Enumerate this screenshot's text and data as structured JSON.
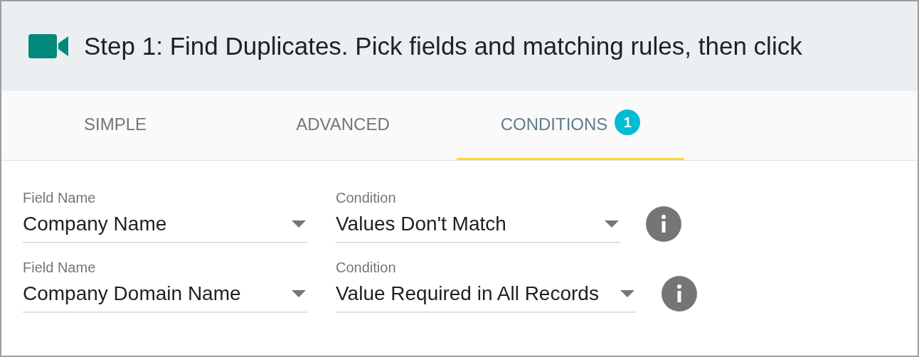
{
  "header": {
    "title": "Step 1: Find Duplicates. Pick fields and matching rules, then click"
  },
  "tabs": [
    {
      "label": "SIMPLE",
      "selected": false
    },
    {
      "label": "ADVANCED",
      "selected": false
    },
    {
      "label": "CONDITIONS",
      "selected": true,
      "badge": "1"
    }
  ],
  "rules": [
    {
      "field_label": "Field Name",
      "field_value": "Company Name",
      "condition_label": "Condition",
      "condition_value": "Values Don't Match"
    },
    {
      "field_label": "Field Name",
      "field_value": "Company Domain Name",
      "condition_label": "Condition",
      "condition_value": "Value Required in All Records"
    }
  ]
}
